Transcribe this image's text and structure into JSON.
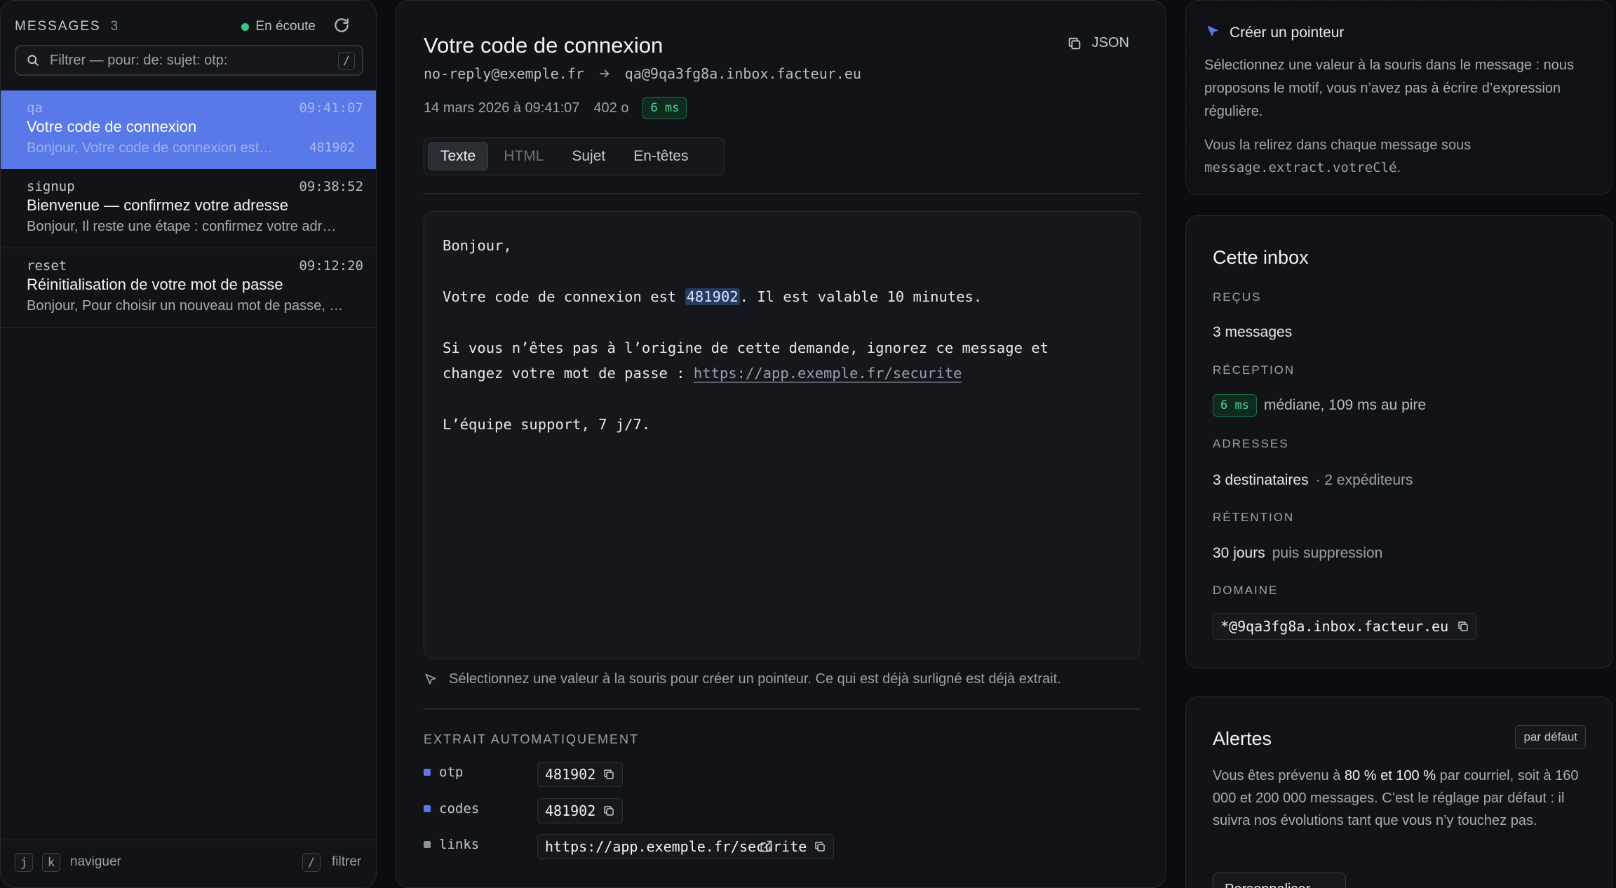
{
  "left": {
    "title": "MESSAGES",
    "count": "3",
    "listening": "En écoute",
    "filter_placeholder": "Filtrer — pour: de: sujet: otp:",
    "filter_kbd": "/",
    "messages": [
      {
        "tag": "qa",
        "time": "09:41:07",
        "subject": "Votre code de connexion",
        "preview": "Bonjour, Votre code de connexion est…",
        "code": "481902",
        "active": true
      },
      {
        "tag": "signup",
        "time": "09:38:52",
        "subject": "Bienvenue — confirmez votre adresse",
        "preview": "Bonjour, Il reste une étape : confirmez votre adr…"
      },
      {
        "tag": "reset",
        "time": "09:12:20",
        "subject": "Réinitialisation de votre mot de passe",
        "preview": "Bonjour, Pour choisir un nouveau mot de passe, …"
      }
    ],
    "footer": {
      "kbd_j": "j",
      "kbd_k": "k",
      "navigate": "naviguer",
      "kbd_slash": "/",
      "filter": "filtrer"
    }
  },
  "message": {
    "subject": "Votre code de connexion",
    "json_label": "JSON",
    "from": "no-reply@exemple.fr",
    "to": "qa@9qa3fg8a.inbox.facteur.eu",
    "date": "14 mars 2026 à 09:41:07",
    "size": "402 o",
    "latency": "6 ms",
    "tabs": [
      "Texte",
      "HTML",
      "Sujet",
      "En-têtes"
    ],
    "body": {
      "greeting": "Bonjour,",
      "line1_before": "Votre code de connexion est ",
      "line1_code": "481902",
      "line1_after": ". Il est valable 10 minutes.",
      "line2a": "Si vous n’êtes pas à l’origine de cette demande, ignorez ce message et",
      "line2b": "changez votre mot de passe : ",
      "line2_link": "https://app.exemple.fr/securite",
      "signature": "L’équipe support, 7 j/7."
    },
    "hint": "Sélectionnez une valeur à la souris pour créer un pointeur. Ce qui est déjà surligné est déjà extrait.",
    "extracted_title": "EXTRAIT AUTOMATIQUEMENT",
    "extracted": [
      {
        "key": "otp",
        "value": "481902"
      },
      {
        "key": "codes",
        "value": "481902"
      },
      {
        "key": "links",
        "value": "https://app.exemple.fr/securite"
      }
    ]
  },
  "tip": {
    "title": "Créer un pointeur",
    "text": "Sélectionnez une valeur à la souris dans le message : nous proposons le motif, vous n’avez pas à écrire d’expression régulière.",
    "text2": "Vous la relirez dans chaque message sous",
    "path": "message.extract.votreClé",
    "period": "."
  },
  "inbox": {
    "title": "Cette inbox",
    "received_label": "REÇUS",
    "received_value": "3 messages",
    "reception_label": "RÉCEPTION",
    "reception_badge": "6 ms",
    "reception_text": "médiane, 109 ms au pire",
    "addresses_label": "ADRESSES",
    "addresses_main": "3 destinataires",
    "addresses_sub": "· 2 expéditeurs",
    "retention_label": "RÉTENTION",
    "retention_main": "30 jours",
    "retention_sub": "puis suppression",
    "domain_label": "DOMAINE",
    "domain_value": "*@9qa3fg8a.inbox.facteur.eu"
  },
  "alerts": {
    "title": "Alertes",
    "badge": "par défaut",
    "text_before": "Vous êtes prévenu à ",
    "text_strong": "80 % et 100 %",
    "text_after": " par courriel, soit à 160 000 et 200 000 messages. C’est le réglage par défaut : il suivra nos évolutions tant que vous n’y touchez pas.",
    "button": "Personnaliser"
  },
  "colors": {
    "accent": "#5a79e8",
    "success": "#36c98a",
    "background": "#0b0c0f"
  }
}
